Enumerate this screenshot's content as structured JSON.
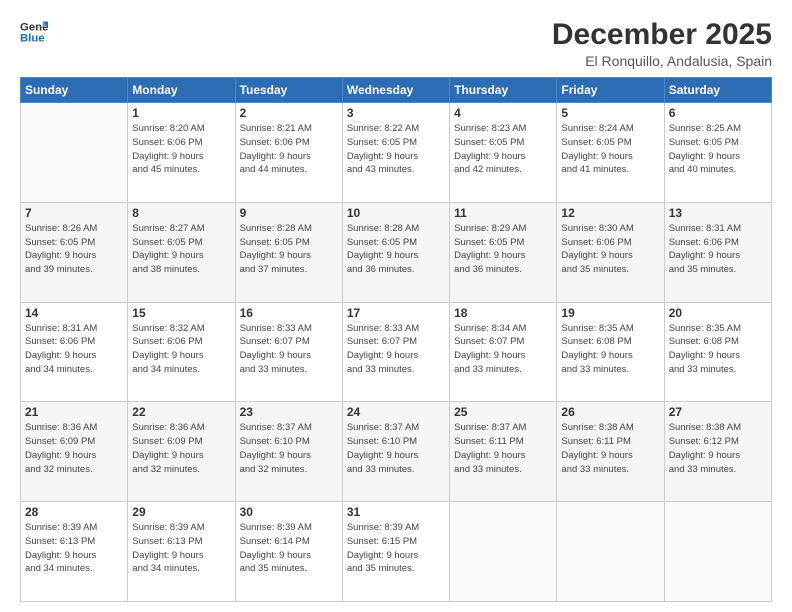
{
  "logo": {
    "line1": "General",
    "line2": "Blue"
  },
  "title": "December 2025",
  "subtitle": "El Ronquillo, Andalusia, Spain",
  "weekdays": [
    "Sunday",
    "Monday",
    "Tuesday",
    "Wednesday",
    "Thursday",
    "Friday",
    "Saturday"
  ],
  "weeks": [
    [
      {
        "day": "",
        "info": ""
      },
      {
        "day": "1",
        "info": "Sunrise: 8:20 AM\nSunset: 6:06 PM\nDaylight: 9 hours\nand 45 minutes."
      },
      {
        "day": "2",
        "info": "Sunrise: 8:21 AM\nSunset: 6:06 PM\nDaylight: 9 hours\nand 44 minutes."
      },
      {
        "day": "3",
        "info": "Sunrise: 8:22 AM\nSunset: 6:05 PM\nDaylight: 9 hours\nand 43 minutes."
      },
      {
        "day": "4",
        "info": "Sunrise: 8:23 AM\nSunset: 6:05 PM\nDaylight: 9 hours\nand 42 minutes."
      },
      {
        "day": "5",
        "info": "Sunrise: 8:24 AM\nSunset: 6:05 PM\nDaylight: 9 hours\nand 41 minutes."
      },
      {
        "day": "6",
        "info": "Sunrise: 8:25 AM\nSunset: 6:05 PM\nDaylight: 9 hours\nand 40 minutes."
      }
    ],
    [
      {
        "day": "7",
        "info": "Sunrise: 8:26 AM\nSunset: 6:05 PM\nDaylight: 9 hours\nand 39 minutes."
      },
      {
        "day": "8",
        "info": "Sunrise: 8:27 AM\nSunset: 6:05 PM\nDaylight: 9 hours\nand 38 minutes."
      },
      {
        "day": "9",
        "info": "Sunrise: 8:28 AM\nSunset: 6:05 PM\nDaylight: 9 hours\nand 37 minutes."
      },
      {
        "day": "10",
        "info": "Sunrise: 8:28 AM\nSunset: 6:05 PM\nDaylight: 9 hours\nand 36 minutes."
      },
      {
        "day": "11",
        "info": "Sunrise: 8:29 AM\nSunset: 6:05 PM\nDaylight: 9 hours\nand 36 minutes."
      },
      {
        "day": "12",
        "info": "Sunrise: 8:30 AM\nSunset: 6:06 PM\nDaylight: 9 hours\nand 35 minutes."
      },
      {
        "day": "13",
        "info": "Sunrise: 8:31 AM\nSunset: 6:06 PM\nDaylight: 9 hours\nand 35 minutes."
      }
    ],
    [
      {
        "day": "14",
        "info": "Sunrise: 8:31 AM\nSunset: 6:06 PM\nDaylight: 9 hours\nand 34 minutes."
      },
      {
        "day": "15",
        "info": "Sunrise: 8:32 AM\nSunset: 6:06 PM\nDaylight: 9 hours\nand 34 minutes."
      },
      {
        "day": "16",
        "info": "Sunrise: 8:33 AM\nSunset: 6:07 PM\nDaylight: 9 hours\nand 33 minutes."
      },
      {
        "day": "17",
        "info": "Sunrise: 8:33 AM\nSunset: 6:07 PM\nDaylight: 9 hours\nand 33 minutes."
      },
      {
        "day": "18",
        "info": "Sunrise: 8:34 AM\nSunset: 6:07 PM\nDaylight: 9 hours\nand 33 minutes."
      },
      {
        "day": "19",
        "info": "Sunrise: 8:35 AM\nSunset: 6:08 PM\nDaylight: 9 hours\nand 33 minutes."
      },
      {
        "day": "20",
        "info": "Sunrise: 8:35 AM\nSunset: 6:08 PM\nDaylight: 9 hours\nand 33 minutes."
      }
    ],
    [
      {
        "day": "21",
        "info": "Sunrise: 8:36 AM\nSunset: 6:09 PM\nDaylight: 9 hours\nand 32 minutes."
      },
      {
        "day": "22",
        "info": "Sunrise: 8:36 AM\nSunset: 6:09 PM\nDaylight: 9 hours\nand 32 minutes."
      },
      {
        "day": "23",
        "info": "Sunrise: 8:37 AM\nSunset: 6:10 PM\nDaylight: 9 hours\nand 32 minutes."
      },
      {
        "day": "24",
        "info": "Sunrise: 8:37 AM\nSunset: 6:10 PM\nDaylight: 9 hours\nand 33 minutes."
      },
      {
        "day": "25",
        "info": "Sunrise: 8:37 AM\nSunset: 6:11 PM\nDaylight: 9 hours\nand 33 minutes."
      },
      {
        "day": "26",
        "info": "Sunrise: 8:38 AM\nSunset: 6:11 PM\nDaylight: 9 hours\nand 33 minutes."
      },
      {
        "day": "27",
        "info": "Sunrise: 8:38 AM\nSunset: 6:12 PM\nDaylight: 9 hours\nand 33 minutes."
      }
    ],
    [
      {
        "day": "28",
        "info": "Sunrise: 8:39 AM\nSunset: 6:13 PM\nDaylight: 9 hours\nand 34 minutes."
      },
      {
        "day": "29",
        "info": "Sunrise: 8:39 AM\nSunset: 6:13 PM\nDaylight: 9 hours\nand 34 minutes."
      },
      {
        "day": "30",
        "info": "Sunrise: 8:39 AM\nSunset: 6:14 PM\nDaylight: 9 hours\nand 35 minutes."
      },
      {
        "day": "31",
        "info": "Sunrise: 8:39 AM\nSunset: 6:15 PM\nDaylight: 9 hours\nand 35 minutes."
      },
      {
        "day": "",
        "info": ""
      },
      {
        "day": "",
        "info": ""
      },
      {
        "day": "",
        "info": ""
      }
    ]
  ]
}
